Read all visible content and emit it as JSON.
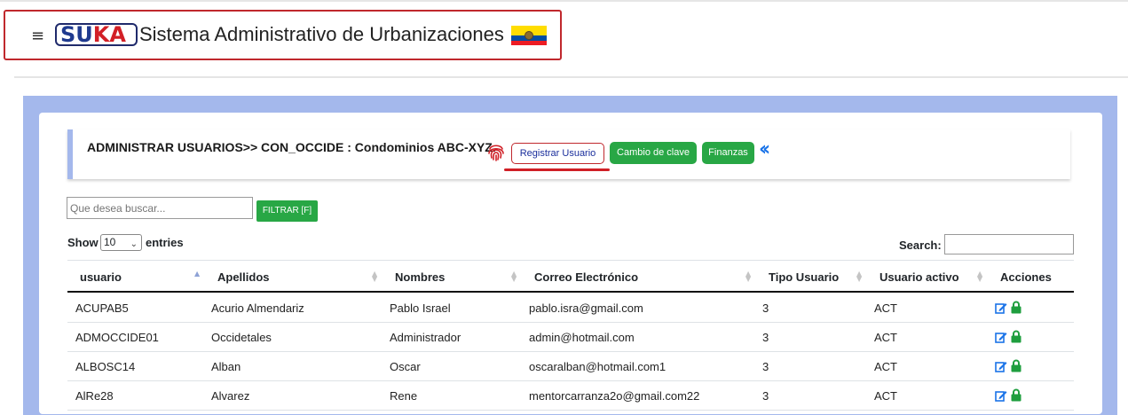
{
  "brand": {
    "logo_su": "SU",
    "logo_ka": "KA",
    "title": "Sistema Administrativo de Urbanizaciones",
    "menu_icon": "hamburger-icon",
    "flag_icon": "ecuador-flag-icon"
  },
  "header": {
    "title": "ADMINISTRAR USUARIOS>> CON_OCCIDE : Condominios ABC-XYZ.",
    "register_button": "Registrar Usuario",
    "password_button": "Cambio de clave",
    "finance_button": "Finanzas",
    "fingerprint_icon": "fingerprint-icon",
    "back_icon": "double-chevron-left-icon"
  },
  "filter": {
    "placeholder": "Que desea buscar...",
    "button": "FILTRAR [F]"
  },
  "controls": {
    "show_label": "Show",
    "page_size": "10",
    "entries_label": "entries",
    "search_label": "Search:"
  },
  "colors": {
    "accent_green": "#28a745",
    "brand_red": "#c0282d",
    "panel_blue": "#a4b8ec",
    "link_blue": "#1a73e8"
  },
  "table": {
    "columns": [
      "usuario",
      "Apellidos",
      "Nombres",
      "Correo Electrónico",
      "Tipo Usuario",
      "Usuario activo",
      "Acciones"
    ],
    "rows": [
      [
        "ACUPAB5",
        "Acurio Almendariz",
        "Pablo Israel",
        "pablo.isra@gmail.com",
        "3",
        "ACT"
      ],
      [
        "ADMOCCIDE01",
        "Occidetales",
        "Administrador",
        "admin@hotmail.com",
        "3",
        "ACT"
      ],
      [
        "ALBOSC14",
        "Alban",
        "Oscar",
        "oscaralban@hotmail.com1",
        "3",
        "ACT"
      ],
      [
        "AlRe28",
        "Alvarez",
        "Rene",
        "mentorcarranza2o@gmail.com22",
        "3",
        "ACT"
      ]
    ],
    "action_icons": [
      "edit-icon",
      "lock-icon"
    ]
  }
}
